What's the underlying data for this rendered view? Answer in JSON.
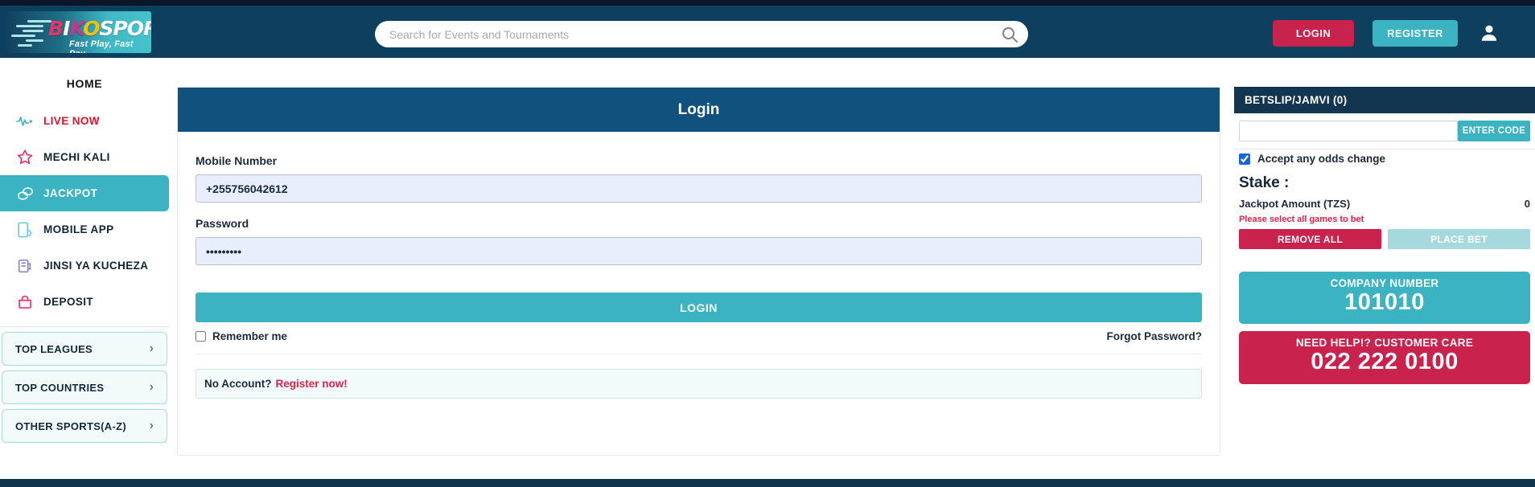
{
  "header": {
    "logo_text_parts": [
      "B",
      "I",
      "K",
      "O",
      "SPORTS"
    ],
    "logo_tagline": "Fast Play, Fast Pay",
    "search_placeholder": "Search for Events and Tournaments",
    "search_value": "",
    "login_label": "LOGIN",
    "register_label": "REGISTER",
    "icons": {
      "search": "search-icon",
      "account": "user-avatar-icon"
    }
  },
  "sidebar": {
    "home_label": "HOME",
    "items": [
      {
        "label": "LIVE NOW",
        "icon": "pulse-icon",
        "active": false
      },
      {
        "label": "MECHI KALI",
        "icon": "star-icon",
        "active": false
      },
      {
        "label": "JACKPOT",
        "icon": "coins-icon",
        "active": true
      },
      {
        "label": "MOBILE APP",
        "icon": "mobile-phone-icon",
        "active": false
      },
      {
        "label": "JINSI YA KUCHEZA",
        "icon": "how-to-play-icon",
        "active": false
      },
      {
        "label": "DEPOSIT",
        "icon": "wallet-icon",
        "active": false
      }
    ],
    "groups": [
      {
        "label": "TOP LEAGUES",
        "chevron": "chevron-right-icon"
      },
      {
        "label": "TOP COUNTRIES",
        "chevron": "chevron-right-icon"
      },
      {
        "label": "OTHER SPORTS(A-Z)",
        "chevron": "chevron-right-icon"
      }
    ]
  },
  "login_card": {
    "title": "Login",
    "mobile_label": "Mobile Number",
    "mobile_value": "+255756042612",
    "password_label": "Password",
    "password_value": "•••••••••",
    "submit_label": "LOGIN",
    "remember_label": "Remember me",
    "remember_checked": false,
    "forgot_label": "Forgot Password?",
    "no_account_text": "No Account?",
    "register_link": "Register now!"
  },
  "betslip": {
    "title": "BETSLIP/JAMVI (0)",
    "code_input_value": "",
    "enter_code_label": "ENTER CODE",
    "odds_change_label": "Accept any odds change",
    "odds_change_checked": true,
    "stake_label": "Stake :",
    "jackpot_amount_label": "Jackpot Amount (TZS)",
    "jackpot_amount_value": "0",
    "warning": "Please select all games to bet",
    "remove_all_label": "REMOVE ALL",
    "place_bet_label": "PLACE BET",
    "company": {
      "title": "COMPANY NUMBER",
      "number": "101010"
    },
    "support": {
      "title": "NEED HELP!? CUSTOMER CARE",
      "number": "022 222 0100"
    }
  },
  "colors": {
    "header_bg": "#0d3f5e",
    "accent_teal": "#3bb3c1",
    "accent_crimson": "#c9224d",
    "card_head_blue": "#10527c",
    "live_red": "#e8112d"
  }
}
